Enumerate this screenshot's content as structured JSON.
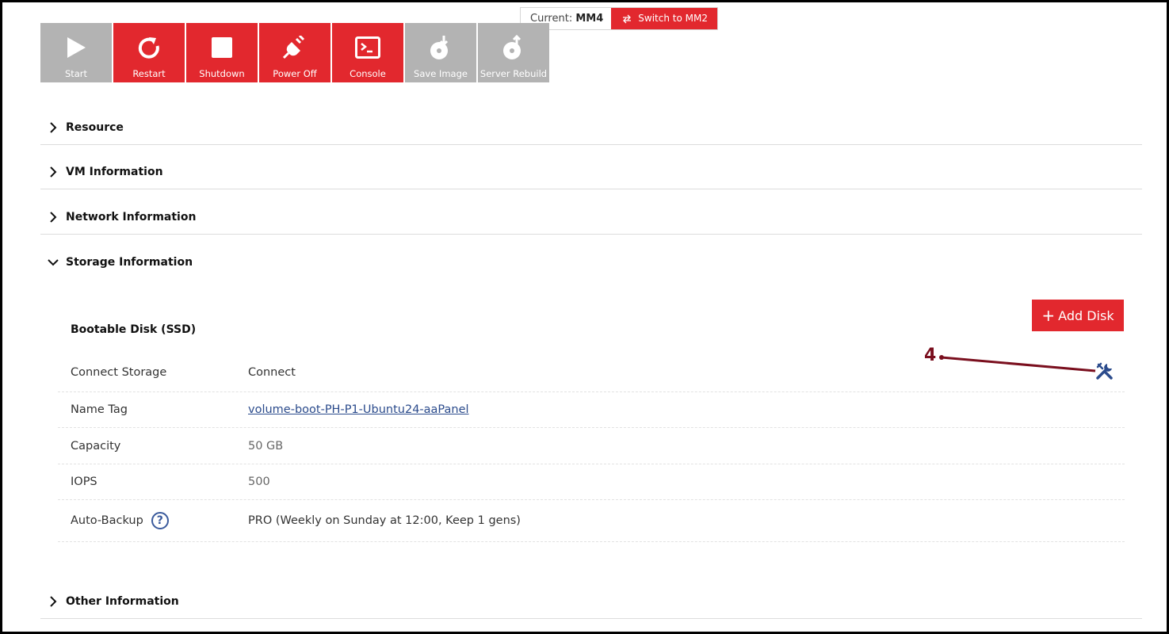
{
  "mm": {
    "current_label": "Current:",
    "current_value": "MM4",
    "switch_label": "Switch to MM2"
  },
  "toolbar": [
    {
      "label": "Start",
      "icon": "play-icon",
      "state": "disabled"
    },
    {
      "label": "Restart",
      "icon": "restart-icon",
      "state": "active"
    },
    {
      "label": "Shutdown",
      "icon": "stop-icon",
      "state": "active"
    },
    {
      "label": "Power Off",
      "icon": "plug-icon",
      "state": "active"
    },
    {
      "label": "Console",
      "icon": "terminal-icon",
      "state": "active"
    },
    {
      "label": "Save Image",
      "icon": "disk-icon",
      "state": "disabled"
    },
    {
      "label": "Server Rebuild",
      "icon": "rebuild-icon",
      "state": "disabled"
    }
  ],
  "sections": {
    "resource": "Resource",
    "vm_info": "VM Information",
    "network_info": "Network Information",
    "storage_info": "Storage Information",
    "other_info": "Other Information"
  },
  "storage": {
    "add_disk_label": "Add Disk",
    "disk_title": "Bootable Disk (SSD)",
    "rows": [
      {
        "key": "Connect Storage",
        "value": "Connect"
      },
      {
        "key": "Name Tag",
        "value": "volume-boot-PH-P1-Ubuntu24-aaPanel"
      },
      {
        "key": "Capacity",
        "value": "50 GB"
      },
      {
        "key": "IOPS",
        "value": "500"
      },
      {
        "key": "Auto-Backup",
        "value": "PRO (Weekly on Sunday at 12:00, Keep 1 gens)"
      }
    ]
  },
  "annotation": {
    "number": "4"
  },
  "colors": {
    "accent": "#e2282e",
    "disabled": "#b3b3b3",
    "link": "#2b4b8c",
    "annotation": "#7a0f1e"
  }
}
